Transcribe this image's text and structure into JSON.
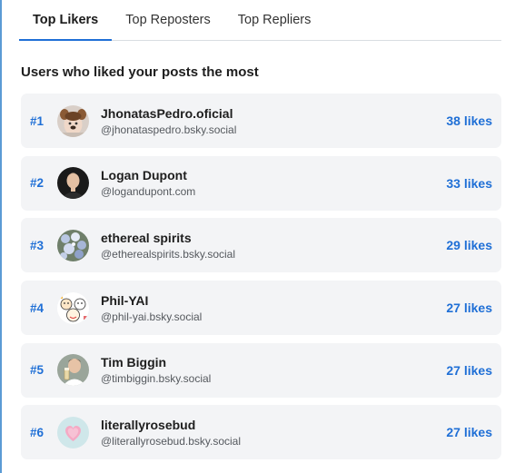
{
  "tabs": [
    {
      "label": "Top Likers",
      "active": true
    },
    {
      "label": "Top Reposters",
      "active": false
    },
    {
      "label": "Top Repliers",
      "active": false
    }
  ],
  "section_title": "Users who liked your posts the most",
  "users": [
    {
      "rank": "#1",
      "name": "JhonatasPedro.oficial",
      "handle": "@jhonataspedro.bsky.social",
      "count": "38 likes",
      "avatar": "avatar-dog-filter-selfie"
    },
    {
      "rank": "#2",
      "name": "Logan Dupont",
      "handle": "@logandupont.com",
      "count": "33 likes",
      "avatar": "avatar-portrait-man"
    },
    {
      "rank": "#3",
      "name": "ethereal spirits",
      "handle": "@etherealspirits.bsky.social",
      "count": "29 likes",
      "avatar": "avatar-flowers"
    },
    {
      "rank": "#4",
      "name": "Phil-YAI",
      "handle": "@phil-yai.bsky.social",
      "count": "27 likes",
      "avatar": "avatar-cartoon-faces"
    },
    {
      "rank": "#5",
      "name": "Tim Biggin",
      "handle": "@timbiggin.bsky.social",
      "count": "27 likes",
      "avatar": "avatar-man-with-glass"
    },
    {
      "rank": "#6",
      "name": "literallyrosebud",
      "handle": "@literallyrosebud.bsky.social",
      "count": "27 likes",
      "avatar": "avatar-pink-heart"
    }
  ],
  "colors": {
    "accent": "#1f6fd6",
    "row_background": "#f3f4f6",
    "tab_divider": "#d9dde2"
  }
}
